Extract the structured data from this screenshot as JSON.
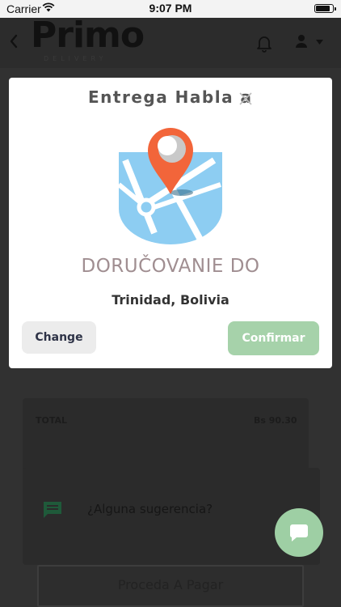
{
  "status_bar": {
    "carrier": "Carrier",
    "time": "9:07 PM",
    "battery_level": 0.9
  },
  "header": {
    "logo_text": "Primo",
    "logo_subtext": "DELIVERY",
    "icons": [
      "back-icon",
      "bell-icon",
      "user-icon",
      "caret-down-icon"
    ]
  },
  "order_summary": {
    "total_label": "TOTAL",
    "total_value": "Bs 90.30"
  },
  "suggestion": {
    "text": "¿Alguna sugerencia?"
  },
  "pay_button": {
    "label": "Proceda A Pagar"
  },
  "modal": {
    "title": "Entrega Habla a",
    "heading": "DORUČOVANIE DO",
    "location": "Trinidad, Bolivia",
    "change_label": "Change",
    "confirm_label": "Confirmar"
  },
  "colors": {
    "accent_green": "#a6d2aa",
    "fab_green": "#9ecfa4",
    "pin_orange": "#f2653a",
    "map_blue": "#8dcdf2",
    "heading_mauve": "#a08e91"
  }
}
